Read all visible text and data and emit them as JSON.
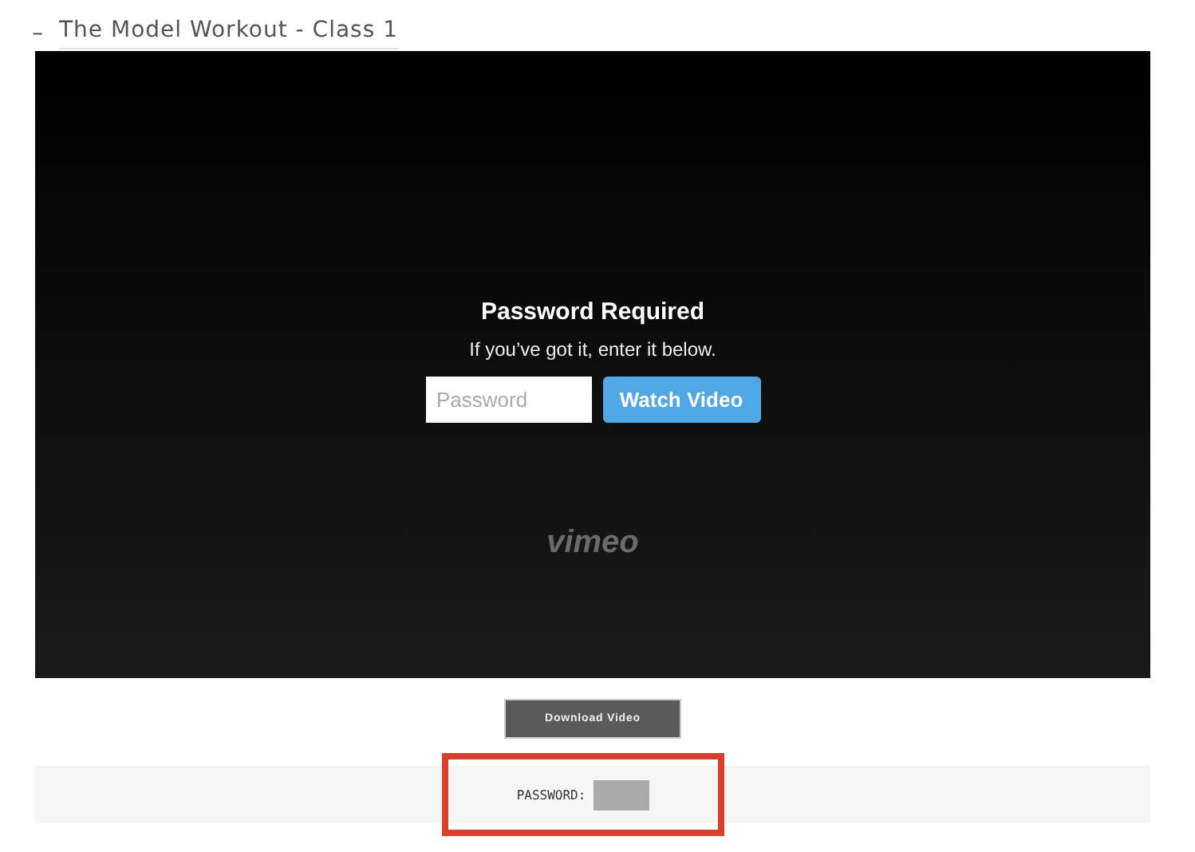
{
  "section": {
    "expanded": true,
    "toggle": "–",
    "title": "The Model Workout - Class 1"
  },
  "player": {
    "heading": "Password Required",
    "subtitle": "If you’ve got it, enter it below.",
    "password_field": {
      "placeholder": "Password"
    },
    "button": "Watch Video",
    "logo": "vimeo"
  },
  "download_button": "Download Video",
  "password_strip": {
    "label": "PASSWORD:",
    "highlighted": true
  }
}
